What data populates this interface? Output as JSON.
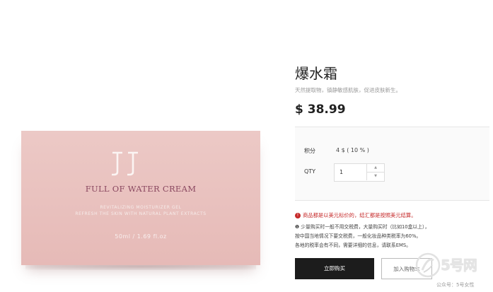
{
  "product_box": {
    "brand_mark": "JJ",
    "title": "FULL OF WATER CREAM",
    "subtitle_1": "REVITALIZING MOISTURIZER GEL",
    "subtitle_2": "REFRESH THE SKIN WITH NATURAL PLANT EXTRACTS",
    "volume": "50ml / 1.69 fl.oz"
  },
  "product": {
    "name": "爆水霜",
    "description": "天然提取物，镇静敏感肌肤，促进皮肤新生。",
    "price": "$ 38.99"
  },
  "options": {
    "points_label": "积分",
    "points_value": "4 $ ( 10 % )",
    "qty_label": "QTY",
    "qty_value": "1"
  },
  "notice": {
    "warning": "商品都是以美元标价的，结汇都是按照美元结算。",
    "line_1": "❶ 少量购买时一般不用交税费，大量购买时（比如10盒以上），",
    "line_2": "按中国当地情况下要交税费，一般化妆品种类税率为60%。",
    "line_3": "各地的税率会有不同，需要详细的信息，请联系EMS。"
  },
  "buttons": {
    "buy_now": "立即购买",
    "add_to_cart": "加入购物车"
  },
  "watermark": {
    "logo_text": "5号网",
    "caption": "公众号：5号女性"
  },
  "colors": {
    "box_pink": "#e8bfbc",
    "title_purple": "#8a4860",
    "warning_red": "#c62a2a",
    "buy_button": "#1c1c1c"
  },
  "icons": {
    "warning": "exclamation-circle-icon",
    "qty_up": "chevron-up-icon",
    "qty_down": "chevron-down-icon"
  }
}
